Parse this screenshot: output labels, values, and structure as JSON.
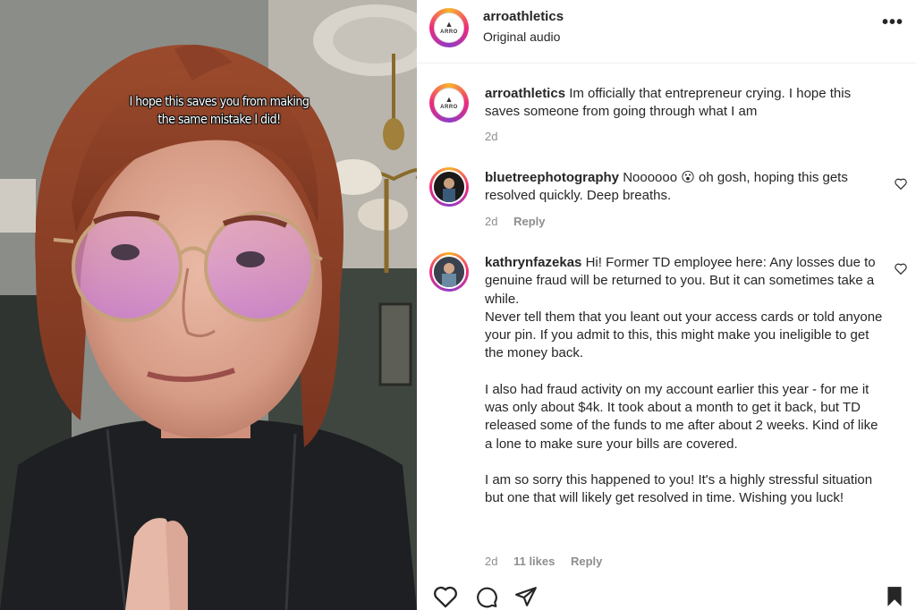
{
  "media": {
    "caption": "I hope this saves you from making the same mistake I did!"
  },
  "post": {
    "username": "arroathletics",
    "audio": "Original audio",
    "more_label": "•••",
    "logo_text": "ARRO"
  },
  "comments": [
    {
      "username": "arroathletics",
      "paragraphs": [
        "Im officially that entrepreneur crying. I hope this saves someone from going through what I am"
      ],
      "time": "2d",
      "likes": "",
      "reply": ""
    },
    {
      "username": "bluetreephotography",
      "paragraphs": [
        "Noooooo 😮 oh gosh, hoping this gets resolved quickly. Deep breaths."
      ],
      "time": "2d",
      "likes": "",
      "reply": "Reply"
    },
    {
      "username": "kathrynfazekas",
      "paragraphs": [
        "Hi! Former TD employee here: Any losses due to genuine fraud will be returned to you. But it can sometimes take a while.",
        "Never tell them that you leant out your access cards or told anyone your pin. If you admit to this, this might make you ineligible to get the money back.",
        "I also had fraud activity on my account earlier this year - for me it was only about $4k. It took about a month to get it back, but TD released some of the funds to me after about 2 weeks. Kind of like a lone to make sure your bills are covered.",
        "I am so sorry this happened to you! It's a highly stressful situation but one that will likely get resolved in time. Wishing you luck!"
      ],
      "time": "2d",
      "likes": "11 likes",
      "reply": "Reply"
    }
  ],
  "actions": [
    "heart-icon",
    "comment-icon",
    "share-icon",
    "bookmark-icon"
  ]
}
